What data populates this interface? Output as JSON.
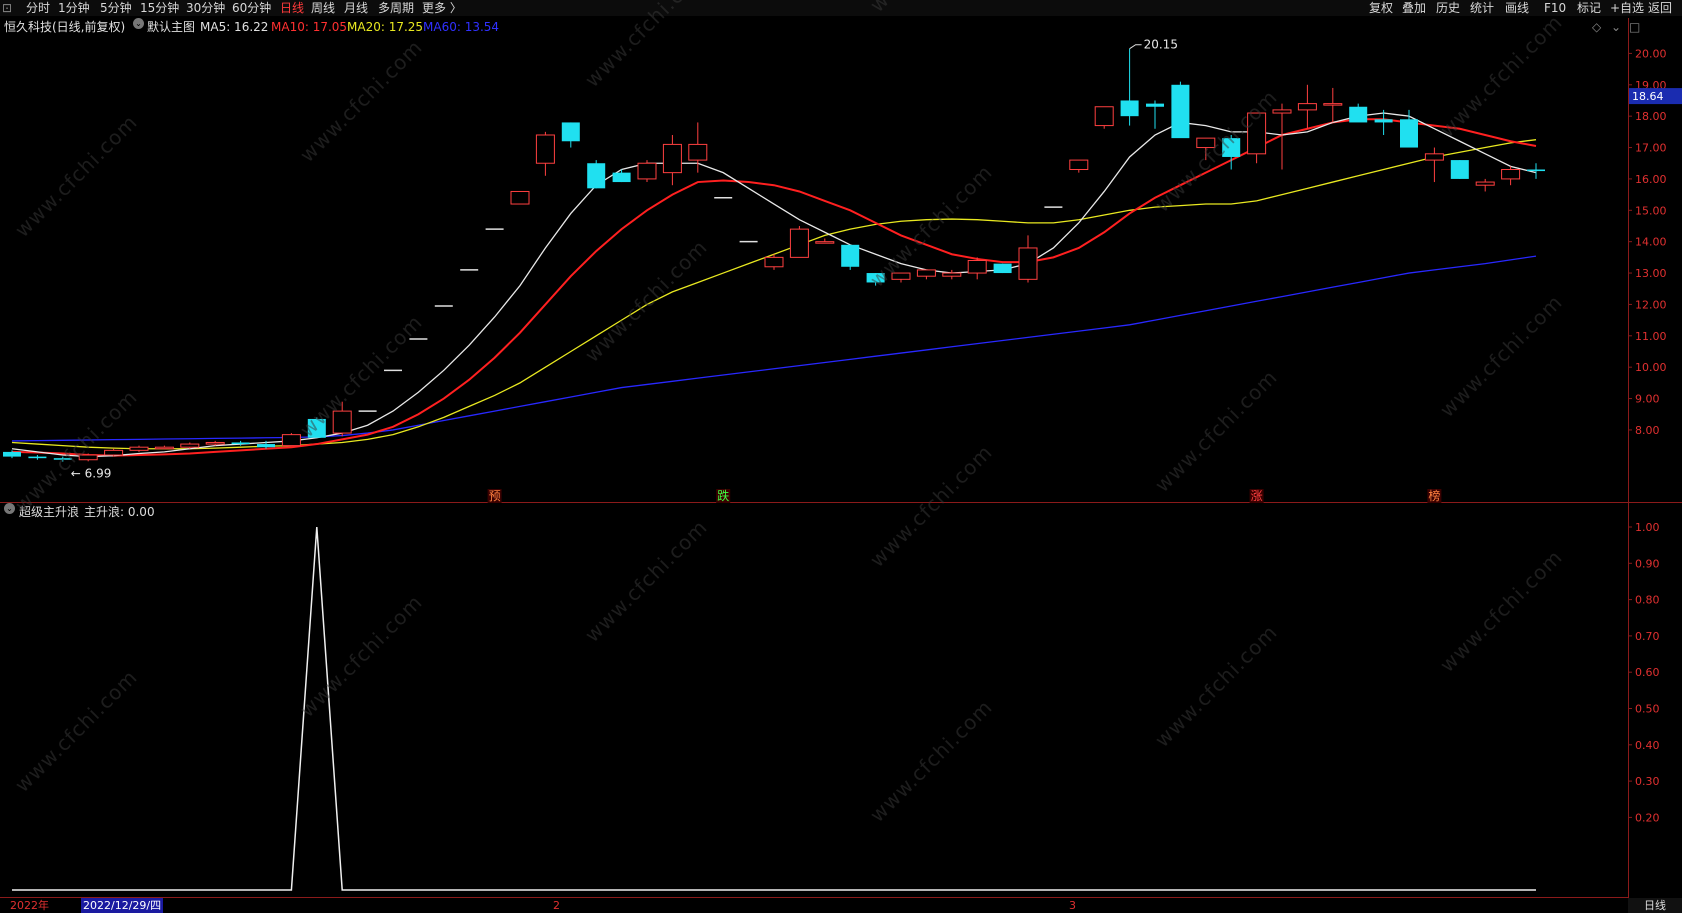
{
  "toolbar": {
    "left_icon": "⊡",
    "tabs": [
      "分时",
      "1分钟",
      "5分钟",
      "15分钟",
      "30分钟",
      "60分钟",
      "日线",
      "周线",
      "月线",
      "多周期",
      "更多 〉"
    ],
    "active_tab": "日线",
    "right_tabs": [
      "复权",
      "叠加",
      "历史",
      "统计",
      "画线",
      "F10",
      "标记",
      "+自选",
      "返回"
    ]
  },
  "main_chart": {
    "stock_title": "恒久科技(日线,前复权)",
    "template": "默认主图",
    "ma5_label": "MA5: 16.22",
    "ma10_label": "MA10: 17.05",
    "ma20_label": "MA20: 17.25",
    "ma60_label": "MA60: 13.54",
    "colors": {
      "ma5": "#e8e8e8",
      "ma10": "#ff2020",
      "ma20": "#e8e820",
      "ma60": "#2828ff",
      "up": "#ff4040",
      "down": "#20e0f0"
    },
    "high_marker": "20.15",
    "low_marker": "6.99",
    "current_price": "18.64",
    "y_labels": [
      "20.00",
      "19.00",
      "18.00",
      "17.00",
      "16.00",
      "15.00",
      "14.00",
      "13.00",
      "12.00",
      "11.00",
      "10.00",
      "9.00",
      "8.00"
    ],
    "signals": [
      {
        "text": "预",
        "color": "#ff8040"
      },
      {
        "text": "跌",
        "color": "#40ff40"
      },
      {
        "text": "涨",
        "color": "#ff4040"
      },
      {
        "text": "榜",
        "color": "#ff8040"
      }
    ],
    "tool_icons": [
      "diamond-icon",
      "chevron-down-icon",
      "maximize-icon"
    ]
  },
  "indicator": {
    "name": "超级主升浪",
    "value_label": "主升浪: 0.00",
    "y_labels": [
      "1.00",
      "0.90",
      "0.80",
      "0.70",
      "0.60",
      "0.50",
      "0.40",
      "0.30",
      "0.20"
    ]
  },
  "date_axis": {
    "year": "2022年",
    "cursor_date": "2022/12/29/四",
    "month_2": "2",
    "month_3": "3"
  },
  "period_label": "日线",
  "watermark": "www.cfchi.com",
  "chart_data": {
    "type": "candlestick",
    "candles": [
      [
        7.3,
        7.35,
        7.1,
        7.15
      ],
      [
        7.15,
        7.2,
        7.05,
        7.1
      ],
      [
        7.1,
        7.15,
        6.99,
        7.05
      ],
      [
        7.05,
        7.25,
        7.0,
        7.2
      ],
      [
        7.2,
        7.4,
        7.15,
        7.35
      ],
      [
        7.35,
        7.5,
        7.3,
        7.45
      ],
      [
        7.45,
        7.5,
        7.4,
        7.45
      ],
      [
        7.45,
        7.6,
        7.4,
        7.55
      ],
      [
        7.55,
        7.65,
        7.5,
        7.6
      ],
      [
        7.6,
        7.65,
        7.5,
        7.55
      ],
      [
        7.55,
        7.65,
        7.4,
        7.45
      ],
      [
        7.5,
        7.9,
        7.5,
        7.85
      ],
      [
        8.35,
        8.4,
        7.8,
        7.75
      ],
      [
        7.9,
        8.9,
        7.8,
        8.6
      ],
      [
        8.6,
        8.6,
        8.6,
        8.6
      ],
      [
        9.9,
        9.9,
        9.9,
        9.9
      ],
      [
        10.9,
        10.9,
        10.9,
        10.9
      ],
      [
        11.95,
        11.95,
        11.95,
        11.95
      ],
      [
        13.1,
        13.1,
        13.1,
        13.1
      ],
      [
        14.4,
        14.4,
        14.4,
        14.4
      ],
      [
        15.2,
        15.5,
        15.2,
        15.6
      ],
      [
        16.5,
        17.5,
        16.1,
        17.4
      ],
      [
        17.8,
        17.8,
        17.0,
        17.2
      ],
      [
        16.5,
        16.6,
        15.7,
        15.7
      ],
      [
        16.2,
        16.3,
        15.9,
        15.9
      ],
      [
        16.0,
        16.6,
        15.9,
        16.5
      ],
      [
        16.2,
        17.4,
        15.8,
        17.1
      ],
      [
        16.6,
        17.8,
        16.2,
        17.1
      ],
      [
        15.4,
        15.4,
        15.4,
        15.4
      ],
      [
        14.0,
        14.0,
        14.0,
        14.0
      ],
      [
        13.2,
        13.6,
        13.1,
        13.5
      ],
      [
        13.5,
        14.5,
        13.5,
        14.4
      ],
      [
        14.0,
        14.1,
        14.0,
        14.0
      ],
      [
        13.9,
        13.9,
        13.1,
        13.2
      ],
      [
        13.0,
        13.0,
        12.6,
        12.7
      ],
      [
        12.8,
        13.0,
        12.7,
        13.0
      ],
      [
        12.9,
        13.1,
        12.8,
        13.1
      ],
      [
        12.9,
        13.1,
        12.8,
        13.0
      ],
      [
        13.0,
        13.5,
        12.8,
        13.4
      ],
      [
        13.3,
        13.3,
        13.0,
        13.0
      ],
      [
        12.8,
        14.2,
        12.7,
        13.8
      ],
      [
        15.1,
        15.1,
        15.1,
        15.1
      ],
      [
        16.3,
        16.6,
        16.2,
        16.6
      ],
      [
        17.7,
        18.3,
        17.6,
        18.3
      ],
      [
        18.5,
        20.15,
        17.7,
        18.0
      ],
      [
        18.4,
        18.5,
        17.6,
        18.3
      ],
      [
        19.0,
        19.1,
        17.4,
        17.3
      ],
      [
        17.0,
        17.3,
        16.6,
        17.3
      ],
      [
        17.3,
        17.4,
        16.3,
        16.7
      ],
      [
        16.8,
        18.1,
        16.5,
        18.1
      ],
      [
        18.1,
        18.4,
        16.3,
        18.2
      ],
      [
        18.2,
        19.0,
        17.6,
        18.4
      ],
      [
        18.4,
        18.9,
        17.8,
        18.4
      ],
      [
        18.3,
        18.4,
        17.9,
        17.8
      ],
      [
        17.9,
        18.2,
        17.4,
        17.8
      ],
      [
        17.9,
        18.2,
        17.0,
        17.0
      ],
      [
        16.6,
        17.0,
        15.9,
        16.8
      ],
      [
        16.6,
        16.6,
        16.0,
        16.0
      ],
      [
        15.8,
        16.0,
        15.6,
        15.9
      ],
      [
        16.0,
        16.4,
        15.8,
        16.3
      ],
      [
        16.3,
        16.5,
        16.0,
        16.25
      ]
    ],
    "ma5": [
      7.4,
      7.3,
      7.2,
      7.15,
      7.18,
      7.25,
      7.3,
      7.4,
      7.5,
      7.55,
      7.6,
      7.65,
      7.75,
      7.9,
      8.15,
      8.6,
      9.2,
      9.9,
      10.7,
      11.6,
      12.6,
      13.8,
      14.9,
      15.8,
      16.3,
      16.5,
      16.5,
      16.5,
      16.2,
      15.7,
      15.2,
      14.7,
      14.3,
      13.9,
      13.6,
      13.3,
      13.1,
      13.0,
      13.05,
      13.1,
      13.3,
      13.8,
      14.6,
      15.6,
      16.7,
      17.4,
      17.8,
      17.7,
      17.5,
      17.5,
      17.4,
      17.5,
      17.8,
      18.0,
      18.1,
      18.0,
      17.6,
      17.2,
      16.8,
      16.4,
      16.2
    ],
    "ma10": [
      7.3,
      7.28,
      7.25,
      7.2,
      7.18,
      7.2,
      7.22,
      7.25,
      7.3,
      7.35,
      7.4,
      7.45,
      7.55,
      7.7,
      7.85,
      8.1,
      8.5,
      9.0,
      9.6,
      10.3,
      11.1,
      12.0,
      12.9,
      13.7,
      14.4,
      15.0,
      15.5,
      15.9,
      15.95,
      15.9,
      15.8,
      15.6,
      15.3,
      15.0,
      14.6,
      14.2,
      13.9,
      13.6,
      13.45,
      13.35,
      13.35,
      13.5,
      13.8,
      14.3,
      14.9,
      15.4,
      15.8,
      16.2,
      16.6,
      17.0,
      17.4,
      17.6,
      17.8,
      17.9,
      17.9,
      17.8,
      17.7,
      17.6,
      17.4,
      17.2,
      17.05
    ],
    "ma20": [
      7.6,
      7.55,
      7.5,
      7.45,
      7.42,
      7.4,
      7.4,
      7.4,
      7.42,
      7.45,
      7.48,
      7.5,
      7.55,
      7.6,
      7.7,
      7.85,
      8.1,
      8.4,
      8.75,
      9.1,
      9.5,
      10.0,
      10.5,
      11.0,
      11.5,
      12.0,
      12.4,
      12.7,
      13.0,
      13.3,
      13.6,
      13.9,
      14.2,
      14.4,
      14.55,
      14.65,
      14.7,
      14.72,
      14.7,
      14.65,
      14.6,
      14.6,
      14.7,
      14.85,
      15.0,
      15.1,
      15.15,
      15.2,
      15.2,
      15.3,
      15.5,
      15.7,
      15.9,
      16.1,
      16.3,
      16.5,
      16.7,
      16.85,
      17.0,
      17.15,
      17.25
    ],
    "ma60": [
      7.65,
      7.66,
      7.67,
      7.68,
      7.69,
      7.7,
      7.71,
      7.72,
      7.73,
      7.74,
      7.75,
      7.76,
      7.78,
      7.82,
      7.9,
      8.0,
      8.15,
      8.3,
      8.45,
      8.6,
      8.75,
      8.9,
      9.05,
      9.2,
      9.35,
      9.45,
      9.55,
      9.65,
      9.75,
      9.85,
      9.95,
      10.05,
      10.15,
      10.25,
      10.35,
      10.45,
      10.55,
      10.65,
      10.75,
      10.85,
      10.95,
      11.05,
      11.15,
      11.25,
      11.35,
      11.5,
      11.65,
      11.8,
      11.95,
      12.1,
      12.25,
      12.4,
      12.55,
      12.7,
      12.85,
      13.0,
      13.1,
      13.2,
      13.3,
      13.42,
      13.54
    ],
    "ylim": [
      6.5,
      20.3
    ],
    "indicator_values": [
      0,
      0,
      0,
      0,
      0,
      0,
      0,
      0,
      0,
      0,
      0,
      0,
      1,
      0,
      0,
      0,
      0,
      0,
      0,
      0,
      0,
      0,
      0,
      0,
      0,
      0,
      0,
      0,
      0,
      0,
      0,
      0,
      0,
      0,
      0,
      0,
      0,
      0,
      0,
      0,
      0,
      0,
      0,
      0,
      0,
      0,
      0,
      0,
      0,
      0,
      0,
      0,
      0,
      0,
      0,
      0,
      0,
      0,
      0,
      0,
      0
    ],
    "indicator_ylim": [
      0,
      1
    ]
  }
}
